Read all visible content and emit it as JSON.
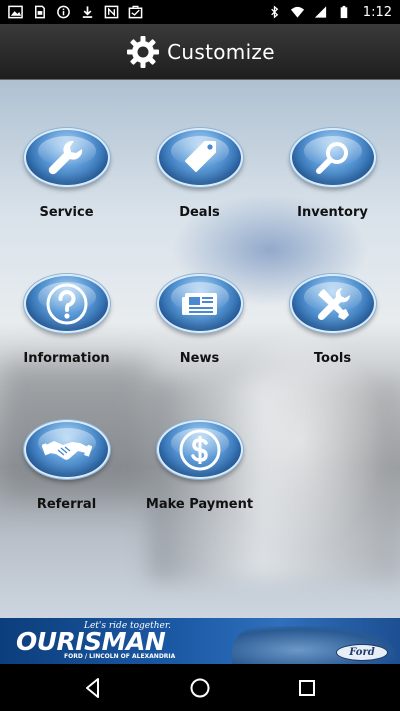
{
  "status_bar": {
    "time": "1:12",
    "left_icons": [
      "gallery-icon",
      "sim-card-icon",
      "info-circle-icon",
      "download-icon",
      "nfc-icon",
      "briefcase-icon"
    ],
    "right_icons": [
      "bluetooth-icon",
      "wifi-icon",
      "signal-icon",
      "battery-icon"
    ]
  },
  "header": {
    "title": "Customize",
    "icon": "gear-icon"
  },
  "menu": {
    "items": [
      {
        "label": "Service",
        "icon": "wrench-icon"
      },
      {
        "label": "Deals",
        "icon": "price-tag-icon"
      },
      {
        "label": "Inventory",
        "icon": "magnifier-icon"
      },
      {
        "label": "Information",
        "icon": "question-icon"
      },
      {
        "label": "News",
        "icon": "newspaper-icon"
      },
      {
        "label": "Tools",
        "icon": "tools-icon"
      },
      {
        "label": "Referral",
        "icon": "handshake-icon"
      },
      {
        "label": "Make Payment",
        "icon": "dollar-coin-icon"
      }
    ]
  },
  "banner": {
    "tagline": "Let's ride together.",
    "brand": "OURISMAN",
    "subtitle": "FORD / LINCOLN OF ALEXANDRIA",
    "logo_text": "Ford"
  },
  "nav": {
    "buttons": [
      "back-icon",
      "home-icon",
      "recents-icon"
    ]
  },
  "colors": {
    "orb": "#3b7cc4",
    "banner": "#1c5aa6",
    "titlebar": "#2b2b2b"
  }
}
